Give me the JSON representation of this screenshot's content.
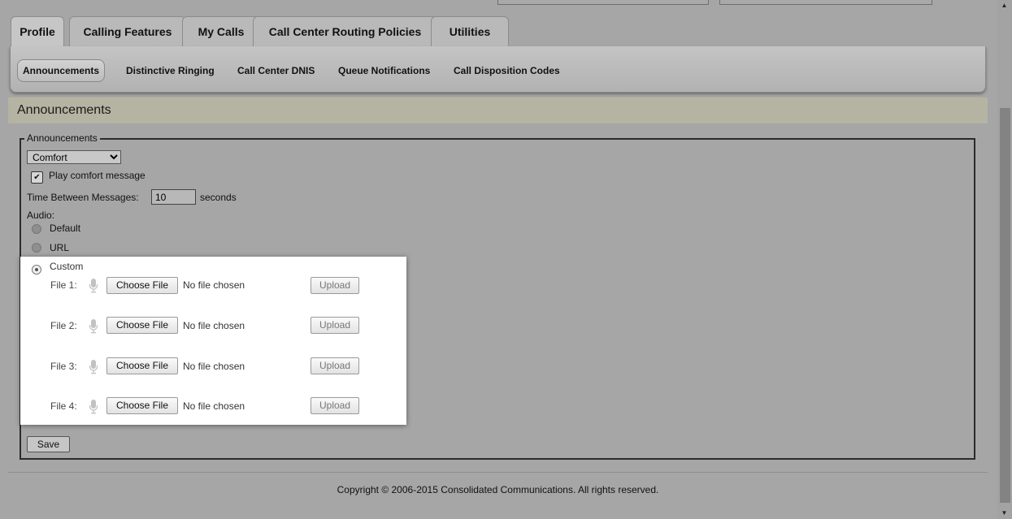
{
  "tabs": [
    {
      "label": "Profile",
      "active": true
    },
    {
      "label": "Calling Features",
      "active": false
    },
    {
      "label": "My Calls",
      "active": false
    },
    {
      "label": "Call Center Routing Policies",
      "active": false
    },
    {
      "label": "Utilities",
      "active": false
    }
  ],
  "subtabs": [
    {
      "label": "Announcements",
      "active": true
    },
    {
      "label": "Distinctive Ringing",
      "active": false
    },
    {
      "label": "Call Center DNIS",
      "active": false
    },
    {
      "label": "Queue Notifications",
      "active": false
    },
    {
      "label": "Call Disposition Codes",
      "active": false
    }
  ],
  "page_title": "Announcements",
  "fieldset_legend": "Announcements",
  "announcement_type": {
    "selected": "Comfort"
  },
  "play_comfort": {
    "label": "Play comfort message",
    "checked": true
  },
  "time_between": {
    "label": "Time Between Messages:",
    "value": "10",
    "unit": "seconds"
  },
  "audio": {
    "label": "Audio:",
    "options": [
      {
        "label": "Default",
        "selected": false
      },
      {
        "label": "URL",
        "selected": false
      },
      {
        "label": "Custom",
        "selected": true
      }
    ]
  },
  "files": [
    {
      "label": "File 1:",
      "choose": "Choose File",
      "status": "No file chosen",
      "upload": "Upload"
    },
    {
      "label": "File 2:",
      "choose": "Choose File",
      "status": "No file chosen",
      "upload": "Upload"
    },
    {
      "label": "File 3:",
      "choose": "Choose File",
      "status": "No file chosen",
      "upload": "Upload"
    },
    {
      "label": "File 4:",
      "choose": "Choose File",
      "status": "No file chosen",
      "upload": "Upload"
    }
  ],
  "save_label": "Save",
  "footer": "Copyright © 2006-2015 Consolidated Communications. All rights reserved.",
  "icons": {
    "microphone": "microphone-icon",
    "scroll_up": "scroll-up-icon",
    "scroll_down": "scroll-down-icon",
    "dropdown": "dropdown-arrow-icon"
  },
  "colors": {
    "background": "#a6a6a6",
    "title_band": "#b5b4a2",
    "panel": "#ffffff"
  }
}
